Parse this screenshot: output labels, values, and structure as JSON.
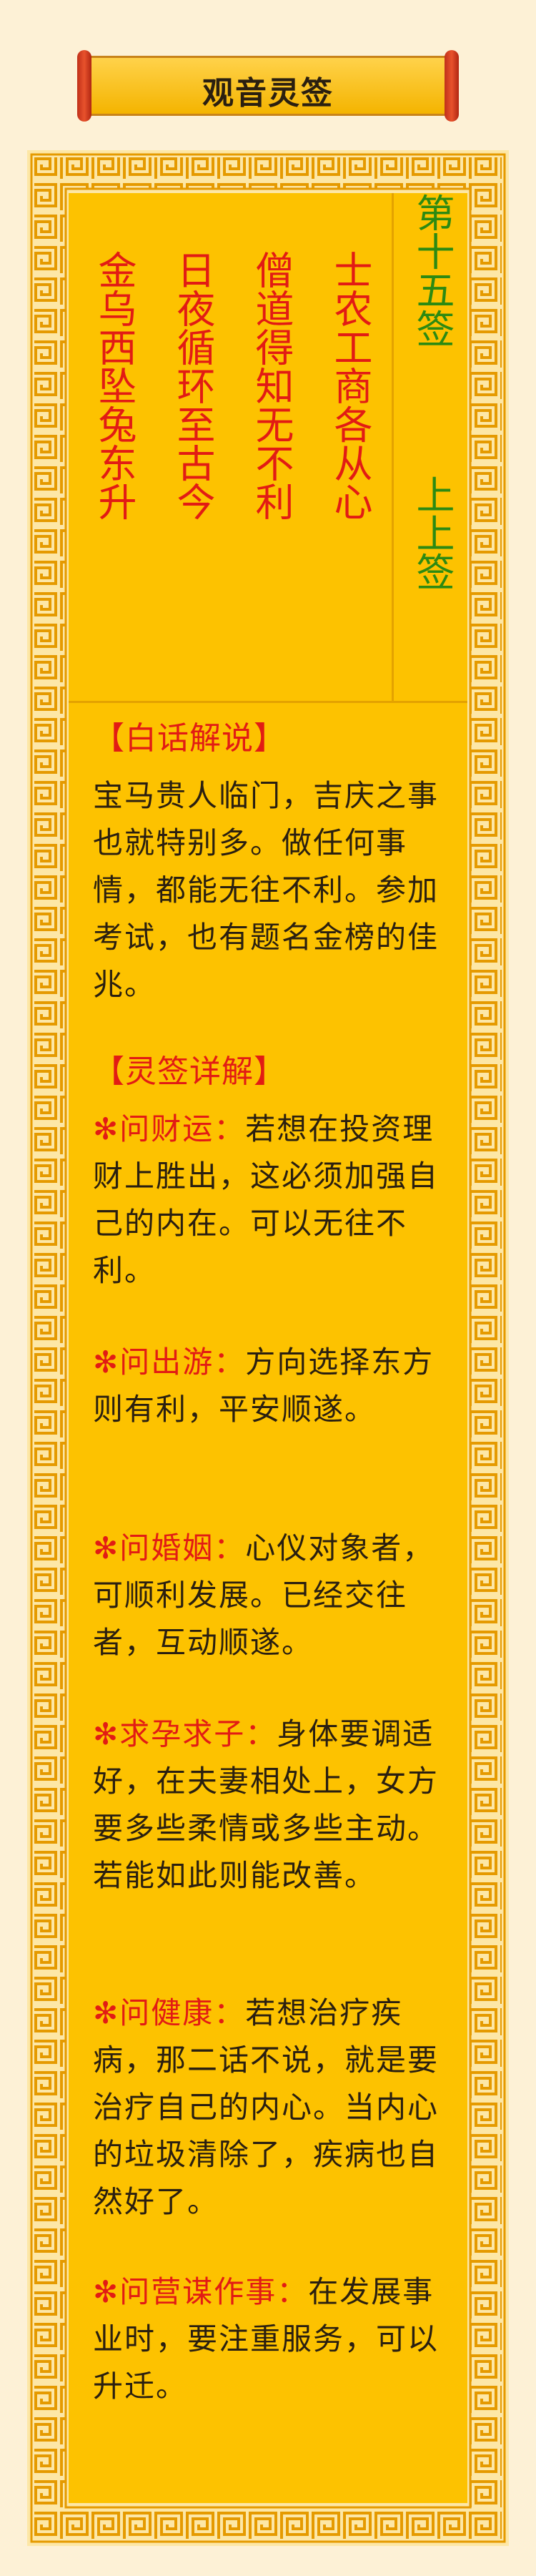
{
  "page": {
    "title": "观音灵签"
  },
  "poem": {
    "columns": [
      "金乌西坠兔东升",
      "日夜循环至古今",
      "僧道得知无不利",
      "士农工商各从心"
    ]
  },
  "sign": {
    "number": "第十五签",
    "grade": "上上签"
  },
  "sections": {
    "vernacular_heading": "【白话解说】",
    "vernacular_text": "宝马贵人临门，吉庆之事也就特别多。做任何事情，都能无往不利。参加考试，也有题名金榜的佳兆。",
    "detail_heading": "【灵签详解】"
  },
  "details": [
    {
      "label": "问财运：",
      "text": "若想在投资理财上胜出，这必须加强自己的内在。可以无往不利。"
    },
    {
      "label": "问出游：",
      "text": "方向选择东方则有利，平安顺遂。"
    },
    {
      "label": "问婚姻：",
      "text": "心仪对象者，可顺利发展。已经交往者，互动顺遂。"
    },
    {
      "label": "求孕求子：",
      "text": "身体要调适好，在夫妻相处上，女方要多些柔情或多些主动。若能如此则能改善。"
    },
    {
      "label": "问健康：",
      "text": "若想治疗疾病，那二话不说，就是要治疗自己的内心。当内心的垃圾清除了，疾病也自然好了。"
    },
    {
      "label": "问营谋作事：",
      "text": "在发展事业时，要注重服务，可以升迁。"
    }
  ],
  "colors": {
    "accent_red": "#e21b14",
    "sign_green": "#2c8a12",
    "panel_yellow": "#fdc200",
    "frame_orange": "#e8a000"
  }
}
